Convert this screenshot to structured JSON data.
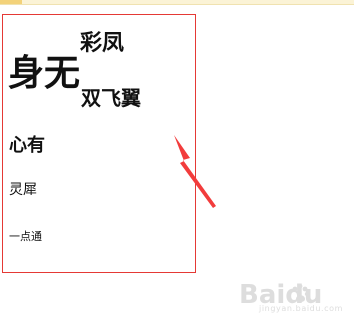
{
  "poem": {
    "big_text": "身无",
    "upper_text": "彩凤",
    "lower_text": "双飞翼",
    "line_1": "心有",
    "line_2": "灵犀",
    "line_3": "一点通"
  },
  "watermark": {
    "brand_text": "Baidu",
    "subtext": "jingyan.baidu.com"
  },
  "colors": {
    "frame": "#e53935",
    "arrow": "#f23c3c",
    "text": "#111111",
    "watermark": "#c9c9c9"
  },
  "icons": {
    "arrow": "arrow-icon",
    "watermark_paw": "paw-icon"
  }
}
